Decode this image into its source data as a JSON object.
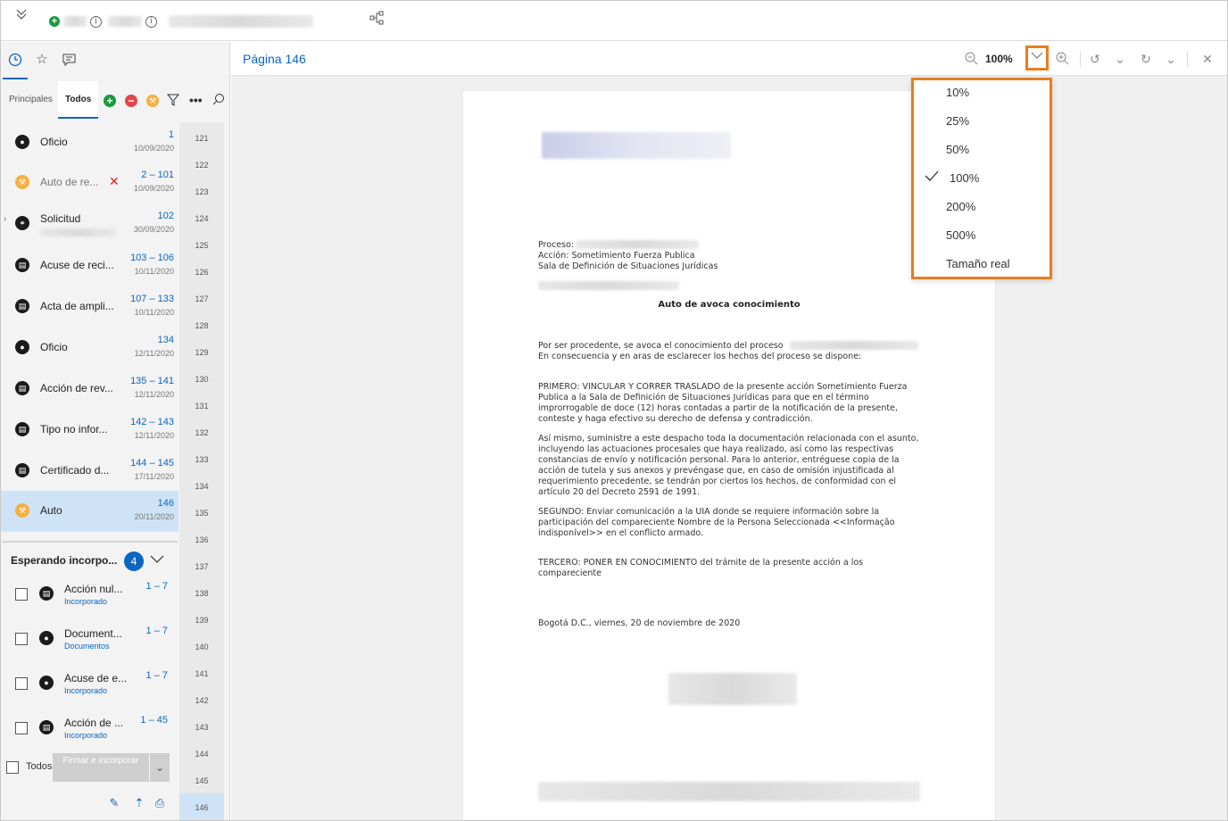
{
  "viewer": {
    "page_label": "Página 146",
    "zoom_value": "100%",
    "zoom_options": [
      "10%",
      "25%",
      "50%",
      "100%",
      "200%",
      "500%",
      "Tamaño real"
    ],
    "zoom_selected": "100%"
  },
  "left": {
    "subtabs": [
      "Principales",
      "Todos"
    ],
    "documents": [
      {
        "title": "Oficio",
        "range": "1",
        "date": "10/09/2020",
        "icon": "person-icon"
      },
      {
        "title": "Auto de re...",
        "range": "2 – 101",
        "date": "10/09/2020",
        "icon": "hammer-icon"
      },
      {
        "title": "Solicitud",
        "range": "102",
        "date": "30/09/2020",
        "icon": "share-icon"
      },
      {
        "title": "Acuse de reci...",
        "range": "103 – 106",
        "date": "10/11/2020",
        "icon": "document-icon"
      },
      {
        "title": "Acta de ampli...",
        "range": "107 – 133",
        "date": "10/11/2020",
        "icon": "document-icon"
      },
      {
        "title": "Oficio",
        "range": "134",
        "date": "12/11/2020",
        "icon": "person-icon"
      },
      {
        "title": "Acción de rev...",
        "range": "135 – 141",
        "date": "12/11/2020",
        "icon": "document-icon"
      },
      {
        "title": "Tipo no infor...",
        "range": "142 – 143",
        "date": "12/11/2020",
        "icon": "document-icon"
      },
      {
        "title": "Certificado d...",
        "range": "144 – 145",
        "date": "17/11/2020",
        "icon": "document-icon"
      },
      {
        "title": "Auto",
        "range": "146",
        "date": "20/11/2020",
        "icon": "hammer-icon"
      }
    ],
    "page_numbers": [
      "121",
      "122",
      "123",
      "124",
      "125",
      "126",
      "127",
      "128",
      "129",
      "130",
      "131",
      "132",
      "133",
      "134",
      "135",
      "136",
      "137",
      "138",
      "139",
      "140",
      "141",
      "142",
      "143",
      "144",
      "145",
      "146"
    ],
    "waiting": {
      "header": "Esperando incorpo...",
      "count": "4",
      "items": [
        {
          "title": "Acción nul...",
          "sub": "Incorporado",
          "range": "1 – 7"
        },
        {
          "title": "Document...",
          "sub": "Documentos",
          "range": "1 – 7"
        },
        {
          "title": "Acuse de e...",
          "sub": "Incorporado",
          "range": "1 – 7"
        },
        {
          "title": "Acción de ...",
          "sub": "Incorporado",
          "range": "1 – 45"
        }
      ],
      "all_label": "Todos",
      "sign_button": "Firmar e incorporar"
    }
  },
  "document": {
    "header_lines": [
      "Proceso:",
      "Acción: Sometimiento Fuerza Publica",
      "Sala de Definición de Situaciones Jurídicas"
    ],
    "title": "Auto de avoca conocimiento",
    "para1": [
      "Por ser procedente, se avoca el conocimiento del proceso",
      "En consecuencia y en aras de esclarecer los hechos del proceso se dispone:"
    ],
    "para2": [
      "PRIMERO: VINCULAR Y CORRER TRASLADO de la presente acción Sometimiento Fuerza",
      "Publica a la Sala de Definición de Situaciones Jurídicas para que en el término",
      "improrrogable de doce (12) horas contadas a partir de la notificación de la presente,",
      "conteste y haga efectivo su derecho de defensa y contradicción."
    ],
    "para3": [
      "Así mismo, suministre a este despacho toda la documentación relacionada con el asunto,",
      "incluyendo las actuaciones procesales que haya realizado, así como las respectivas",
      "constancias de envío y notificación personal. Para lo anterior, entréguese copia de la",
      "acción de tutela y sus anexos y prevéngase que, en caso de omisión injustificada al",
      "requerimiento precedente, se tendrán por ciertos los hechos, de conformidad con el",
      "artículo 20 del Decreto 2591 de 1991."
    ],
    "para4": [
      "SEGUNDO: Enviar comunicación a la UIA donde se requiere información sobre la",
      "participación del compareciente Nombre de la Persona Seleccionada <<Informação",
      "indisponível>> en el conflicto armado."
    ],
    "para5": [
      "TERCERO: PONER EN CONOCIMIENTO del trámite de la presente acción a los",
      "compareciente"
    ],
    "closing": "Bogotá D.C., viernes, 20 de noviembre de 2020"
  }
}
